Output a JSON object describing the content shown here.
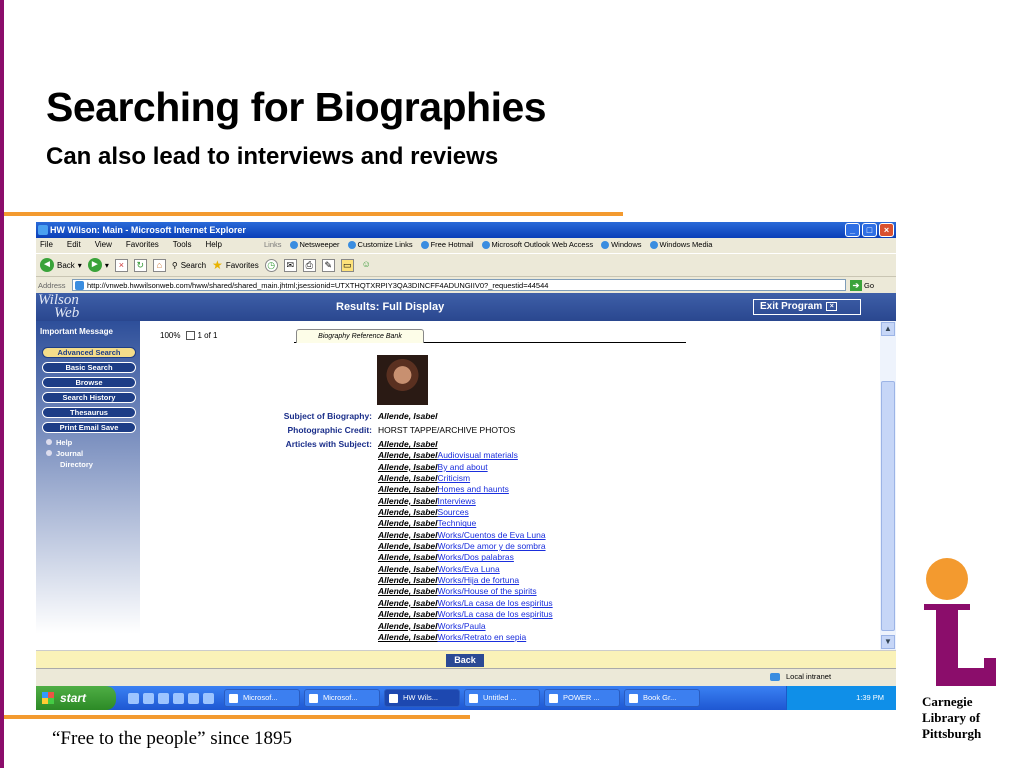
{
  "slide": {
    "title": "Searching for Biographies",
    "subtitle": "Can also lead to interviews and reviews",
    "footer": "“Free to the people” since 1895",
    "logo_text": [
      "Carnegie",
      "Library of",
      "Pittsburgh"
    ],
    "accent_colors": {
      "purple": "#8b0d6b",
      "orange": "#f39a2f"
    }
  },
  "browser": {
    "window_title": "HW Wilson: Main - Microsoft Internet Explorer",
    "menu": [
      "File",
      "Edit",
      "View",
      "Favorites",
      "Tools",
      "Help"
    ],
    "links_label": "Links",
    "links": [
      "Netsweeper",
      "Customize Links",
      "Free Hotmail",
      "Microsoft Outlook Web Access",
      "Windows",
      "Windows Media"
    ],
    "toolbar": {
      "back": "Back",
      "search": "Search",
      "favorites": "Favorites"
    },
    "address_label": "Address",
    "address": "http://vnweb.hwwilsonweb.com/hww/shared/shared_main.jhtml;jsessionid=UTXTHQTXRPIY3QA3DINCFF4ADUNGIIV0?_requestid=44544",
    "go_label": "Go"
  },
  "wilson": {
    "logo": [
      "Wilson",
      "Web"
    ],
    "results_title": "Results: Full Display",
    "exit_label": "Exit Program",
    "sidebar_heading": "Important Message",
    "sidebar_buttons": [
      "Advanced Search",
      "Basic Search",
      "Browse",
      "Search History",
      "Thesaurus",
      "Print Email Save"
    ],
    "sidebar_links": {
      "help": "Help",
      "journal": "Journal",
      "directory": "Directory"
    },
    "zoom": "100%",
    "page_count": "1 of 1",
    "tab": "Biography Reference Bank",
    "subject_label": "Subject of Biography:",
    "subject_value": "Allende, Isabel",
    "credit_label": "Photographic Credit:",
    "credit_value": "HORST TAPPE/ARCHIVE PHOTOS",
    "articles_label": "Articles with Subject:",
    "articles_subject": "Allende, Isabel",
    "article_suffixes": [
      "Audiovisual materials",
      "By and about",
      "Criticism",
      "Homes and haunts",
      "Interviews",
      "Sources",
      "Technique",
      "Works/Cuentos de Eva Luna",
      "Works/De amor y de sombra",
      "Works/Dos palabras",
      "Works/Eva Luna",
      "Works/Hija de fortuna",
      "Works/House of the spirits",
      "Works/La casa de los espiritus",
      "Works/La casa de los espiritus",
      "Works/Paula",
      "Works/Retrato en sepia"
    ],
    "back_label": "Back"
  },
  "status": {
    "zone": "Local intranet"
  },
  "taskbar": {
    "start": "start",
    "tasks": [
      "Microsof...",
      "Microsof...",
      "HW Wils...",
      "Untitled ...",
      "POWER ...",
      "Book Gr..."
    ],
    "clock": "1:39 PM"
  }
}
